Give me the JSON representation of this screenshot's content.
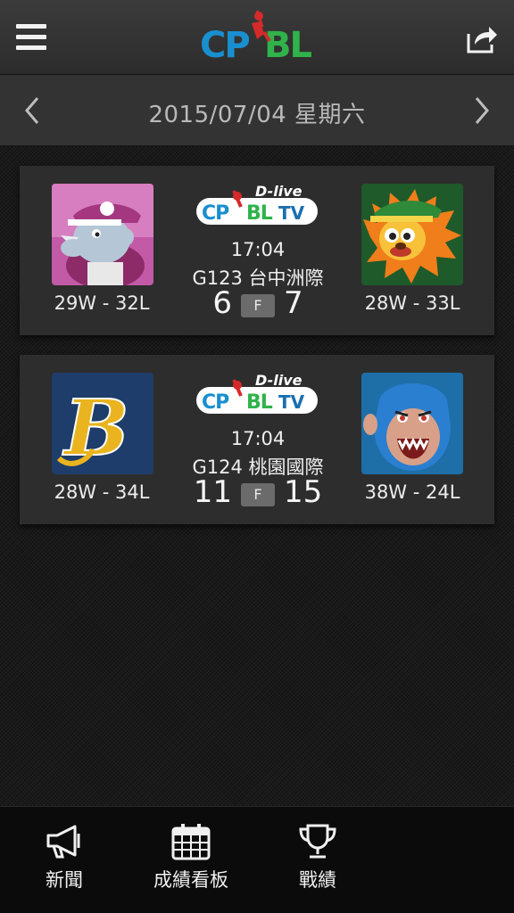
{
  "header": {
    "menu_icon": "hamburger-menu-icon",
    "logo_text": "CPBL",
    "share_icon": "share-icon"
  },
  "datebar": {
    "date": "2015/07/04 星期六",
    "prev_icon": "chevron-left-icon",
    "next_icon": "chevron-right-icon"
  },
  "games": [
    {
      "tv_logo_text": "CPBL TV",
      "tv_logo_sub": "D-live",
      "time": "17:04",
      "venue": "G123 台中洲際",
      "away_score": "6",
      "home_score": "7",
      "status": "F",
      "away_record": "29W - 32L",
      "home_record": "28W - 33L",
      "away_logo": "rhino-mascot-logo",
      "home_logo": "lion-mascot-logo"
    },
    {
      "tv_logo_text": "CPBL TV",
      "tv_logo_sub": "D-live",
      "time": "17:04",
      "venue": "G124 桃園國際",
      "away_score": "11",
      "home_score": "15",
      "status": "F",
      "away_record": "28W - 34L",
      "home_record": "38W - 24L",
      "away_logo": "b-letter-logo",
      "home_logo": "monkey-mascot-logo"
    }
  ],
  "bottom_nav": [
    {
      "label": "新聞",
      "icon": "megaphone-icon"
    },
    {
      "label": "成績看板",
      "icon": "calendar-icon"
    },
    {
      "label": "戰績",
      "icon": "trophy-icon"
    }
  ],
  "colors": {
    "header_bg": "#333333",
    "card_bg": "#2d2d2d",
    "logo_blue": "#1a8fd0",
    "logo_green": "#2fb34a",
    "logo_red": "#d42a2a"
  }
}
